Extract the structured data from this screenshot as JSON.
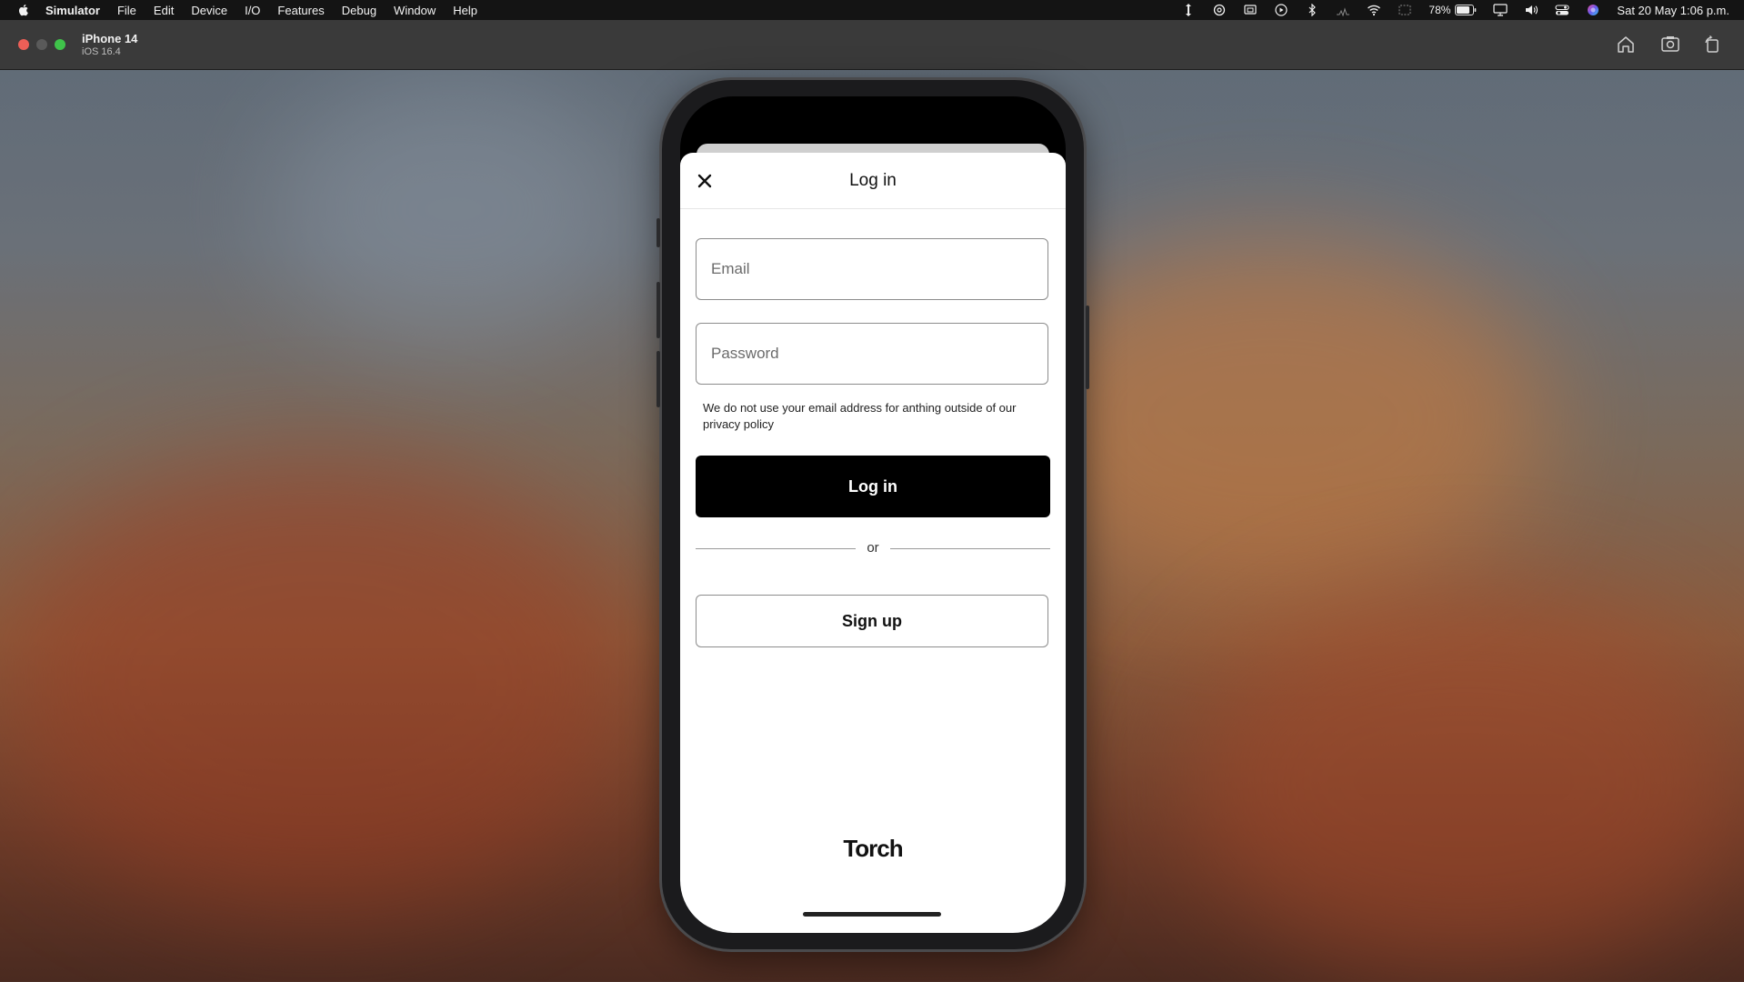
{
  "menubar": {
    "app_name": "Simulator",
    "items": [
      "File",
      "Edit",
      "Device",
      "I/O",
      "Features",
      "Debug",
      "Window",
      "Help"
    ],
    "battery_percent": "78%",
    "datetime": "Sat 20 May  1:06 p.m."
  },
  "simulator": {
    "device_name": "iPhone 14",
    "os_version": "iOS 16.4"
  },
  "sheet": {
    "title": "Log in",
    "email_placeholder": "Email",
    "password_placeholder": "Password",
    "notice": "We do not use your email address for anthing outside of our privacy policy",
    "login_label": "Log in",
    "or_label": "or",
    "signup_label": "Sign up",
    "logo_text": "Torch"
  },
  "colors": {
    "primary_button": "#000000",
    "sheet_bg": "#ffffff"
  }
}
